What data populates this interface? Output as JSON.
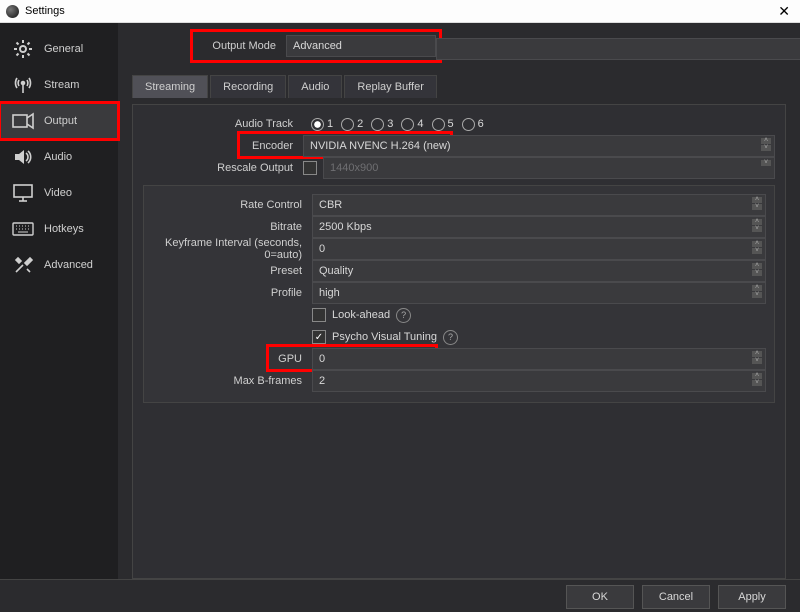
{
  "window": {
    "title": "Settings"
  },
  "sidebar": {
    "items": [
      {
        "label": "General"
      },
      {
        "label": "Stream"
      },
      {
        "label": "Output"
      },
      {
        "label": "Audio"
      },
      {
        "label": "Video"
      },
      {
        "label": "Hotkeys"
      },
      {
        "label": "Advanced"
      }
    ]
  },
  "output_mode": {
    "label": "Output Mode",
    "value": "Advanced"
  },
  "tabs": [
    "Streaming",
    "Recording",
    "Audio",
    "Replay Buffer"
  ],
  "audio_track": {
    "label": "Audio Track",
    "options": [
      "1",
      "2",
      "3",
      "4",
      "5",
      "6"
    ]
  },
  "encoder": {
    "label": "Encoder",
    "value": "NVIDIA NVENC H.264 (new)"
  },
  "rescale": {
    "label": "Rescale Output",
    "placeholder": "1440x900"
  },
  "settings": {
    "rate_control": {
      "label": "Rate Control",
      "value": "CBR"
    },
    "bitrate": {
      "label": "Bitrate",
      "value": "2500 Kbps"
    },
    "keyframe": {
      "label": "Keyframe Interval (seconds, 0=auto)",
      "value": "0"
    },
    "preset": {
      "label": "Preset",
      "value": "Quality"
    },
    "profile": {
      "label": "Profile",
      "value": "high"
    },
    "lookahead": {
      "label": "Look-ahead"
    },
    "psycho": {
      "label": "Psycho Visual Tuning"
    },
    "gpu": {
      "label": "GPU",
      "value": "0"
    },
    "max_b": {
      "label": "Max B-frames",
      "value": "2"
    }
  },
  "footer": {
    "ok": "OK",
    "cancel": "Cancel",
    "apply": "Apply"
  }
}
